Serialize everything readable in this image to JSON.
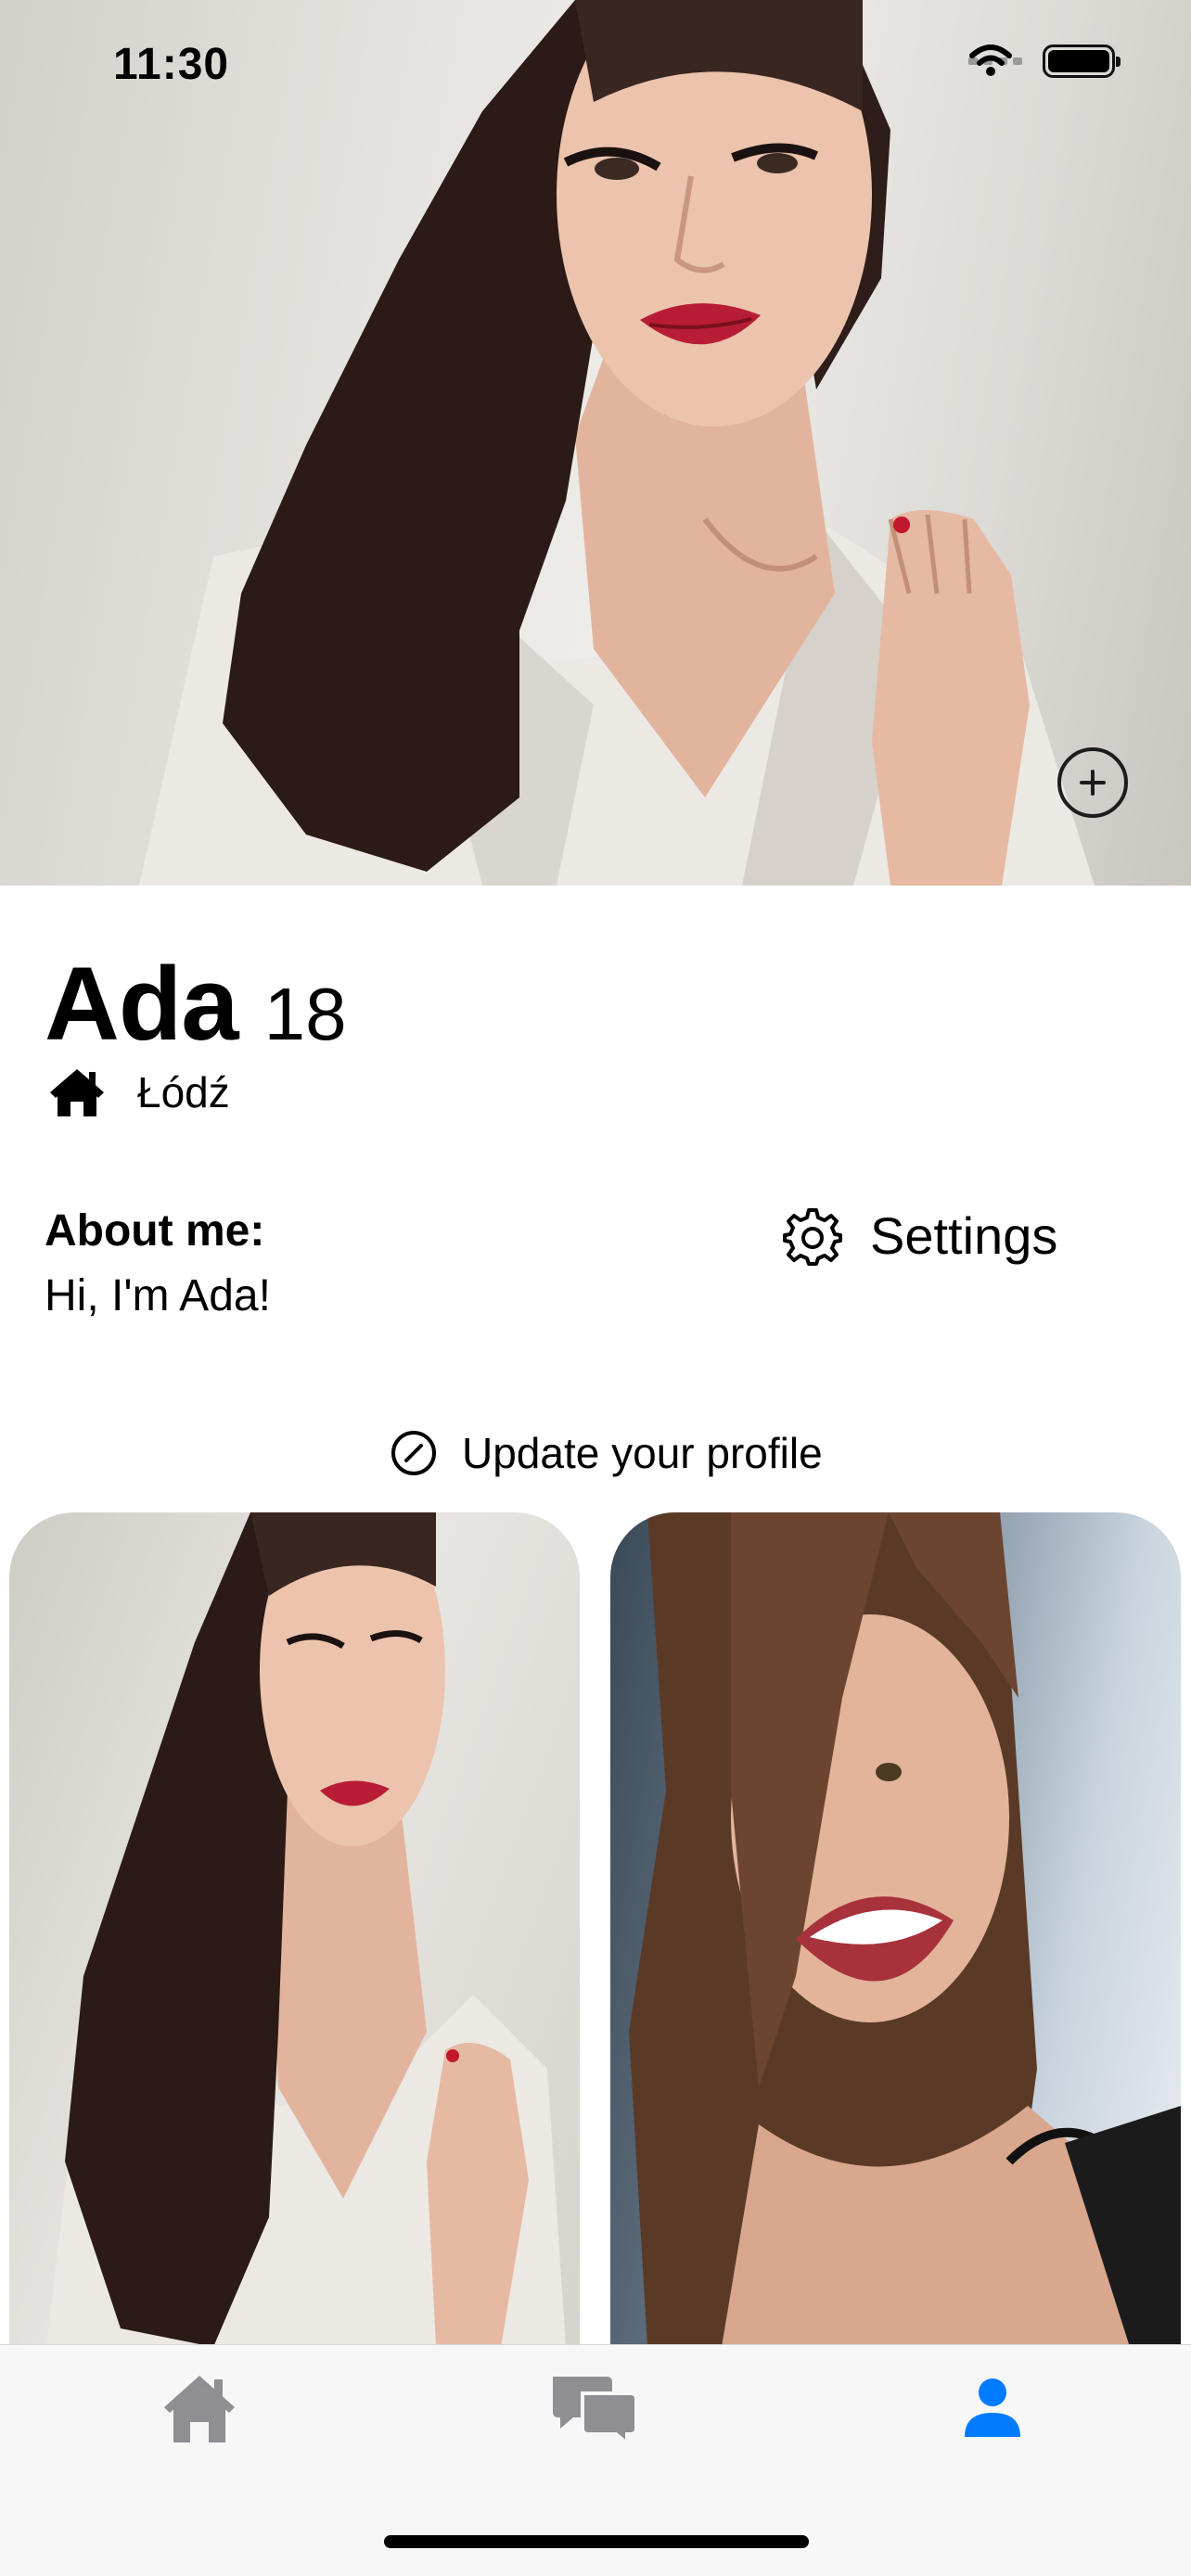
{
  "status_bar": {
    "time": "11:30"
  },
  "profile": {
    "name": "Ada",
    "age": "18",
    "city": "Łódź",
    "about_label": "About me:",
    "about_text": "Hi, I'm Ada!"
  },
  "actions": {
    "settings_label": "Settings",
    "update_label": "Update your profile"
  },
  "icons": {
    "home": "house-icon",
    "settings": "gear-icon",
    "update": "slash-circle-icon",
    "add_photo": "plus-circle-icon",
    "tab_home": "house-icon",
    "tab_messages": "chat-bubbles-icon",
    "tab_profile": "person-icon"
  },
  "tabs": [
    {
      "id": "home",
      "selected": false
    },
    {
      "id": "messages",
      "selected": false
    },
    {
      "id": "profile",
      "selected": true
    }
  ],
  "colors": {
    "accent": "#007aff",
    "tab_inactive": "#8e8e93"
  }
}
